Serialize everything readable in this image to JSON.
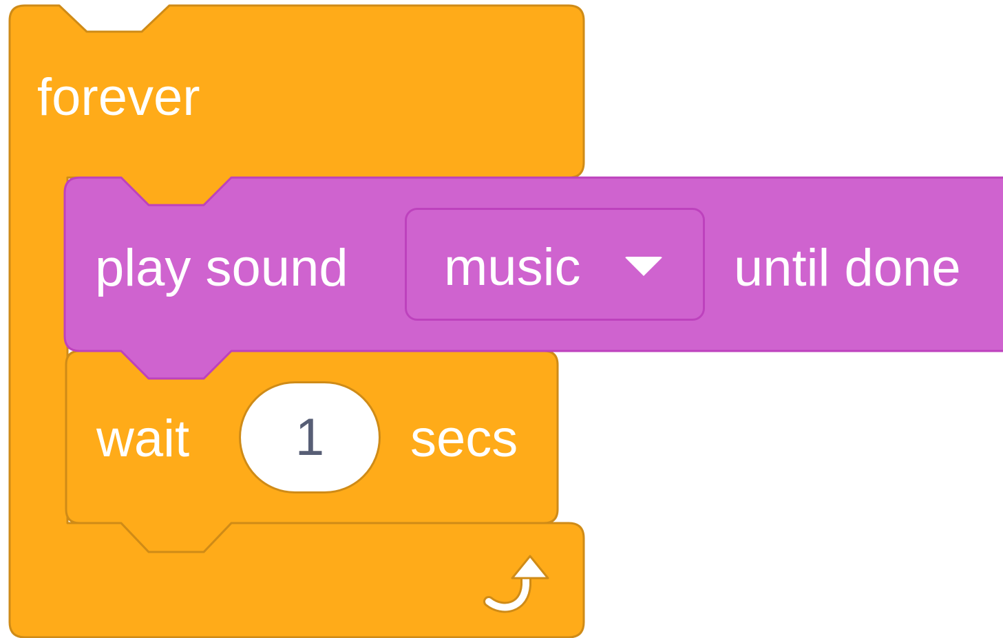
{
  "colors": {
    "control_fill": "#ffab19",
    "control_stroke": "#cf8b17",
    "sound_fill": "#cf63cf",
    "sound_stroke": "#bd42bd",
    "text": "#ffffff",
    "input_text": "#575e75",
    "input_fill": "#ffffff"
  },
  "forever_block": {
    "label": "forever",
    "end_icon": "loop-arrow-icon"
  },
  "play_sound_block": {
    "label_prefix": "play sound",
    "sound_menu": {
      "selected": "music",
      "icon": "dropdown-caret-icon"
    },
    "label_suffix": "until done"
  },
  "wait_block": {
    "label_prefix": "wait",
    "duration": "1",
    "label_suffix": "secs"
  }
}
